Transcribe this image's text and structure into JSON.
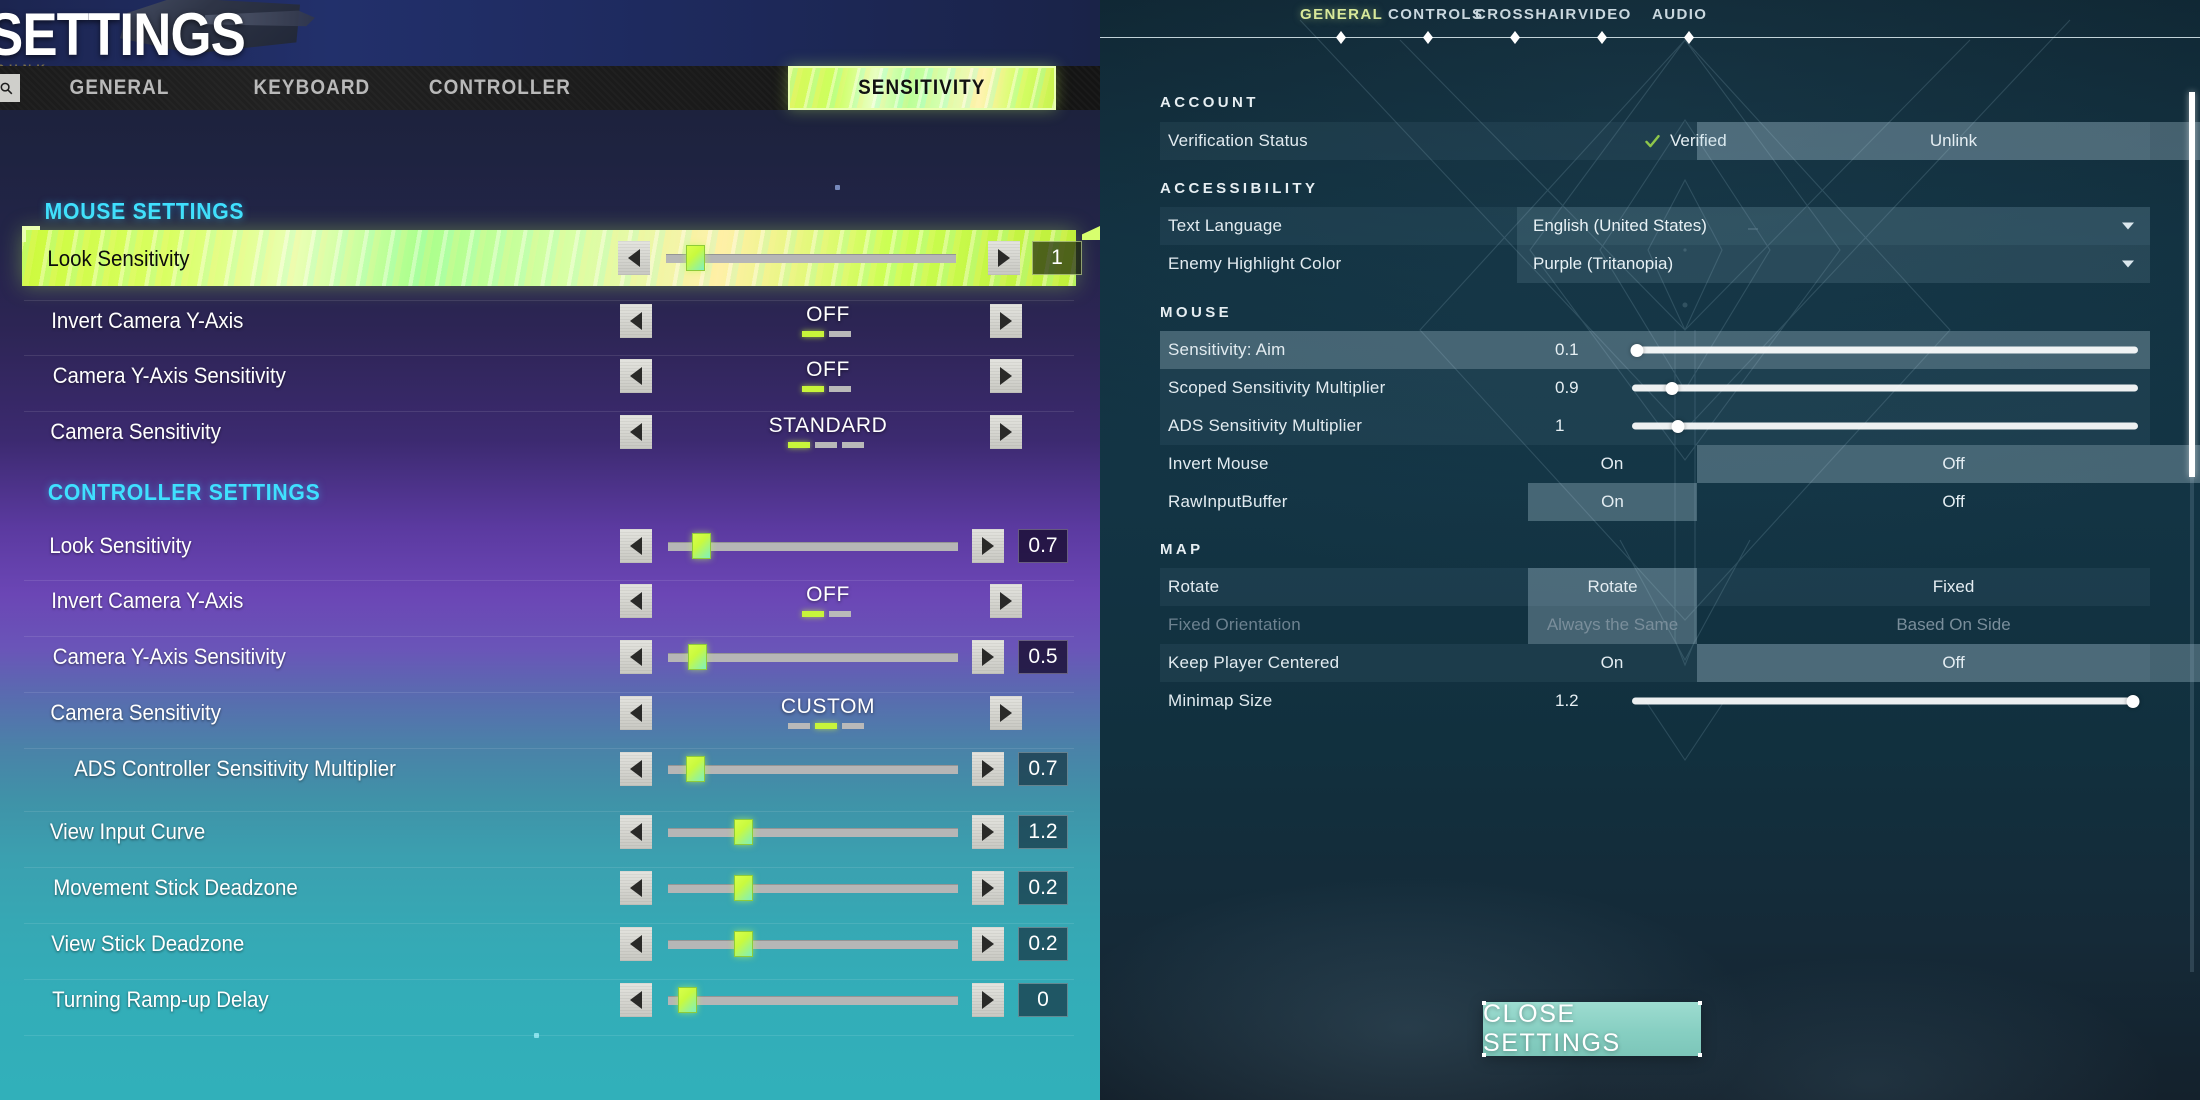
{
  "left": {
    "title": "SETTINGS",
    "subtitle": "PUNK",
    "search_icon": "search-icon",
    "tabs": [
      {
        "label": "GENERAL",
        "active": false
      },
      {
        "label": "KEYBOARD",
        "active": false
      },
      {
        "label": "CONTROLLER",
        "active": false
      },
      {
        "label": "SENSITIVITY",
        "active": true
      }
    ],
    "sections": [
      {
        "heading": "MOUSE SETTINGS",
        "rows": [
          {
            "label": "Look Sensitivity",
            "type": "slider",
            "value": "1",
            "fill": 0.05,
            "highlighted": true
          },
          {
            "label": "Invert Camera Y-Axis",
            "type": "option",
            "value": "OFF",
            "segments": 2,
            "segment_active": 0
          },
          {
            "label": "Camera Y-Axis Sensitivity",
            "type": "option",
            "value": "OFF",
            "segments": 2,
            "segment_active": 0
          },
          {
            "label": "Camera Sensitivity",
            "type": "option",
            "value": "STANDARD",
            "segments": 3,
            "segment_active": 0
          }
        ]
      },
      {
        "heading": "CONTROLLER SETTINGS",
        "rows": [
          {
            "label": "Look Sensitivity",
            "type": "slider",
            "value": "0.7",
            "fill": 0.1
          },
          {
            "label": "Invert Camera Y-Axis",
            "type": "option",
            "value": "OFF",
            "segments": 2,
            "segment_active": 0
          },
          {
            "label": "Camera Y-Axis Sensitivity",
            "type": "slider",
            "value": "0.5",
            "fill": 0.07
          },
          {
            "label": "Camera Sensitivity",
            "type": "option",
            "value": "CUSTOM",
            "segments": 3,
            "segment_active": 1
          },
          {
            "label": "ADS Controller Sensitivity Multiplier",
            "type": "slider",
            "value": "0.7",
            "fill": 0.06,
            "indent": true
          },
          {
            "label": "View Input Curve",
            "type": "slider",
            "value": "1.2",
            "fill": 0.22
          },
          {
            "label": "Movement Stick Deadzone",
            "type": "slider",
            "value": "0.2",
            "fill": 0.22
          },
          {
            "label": "View Stick Deadzone",
            "type": "slider",
            "value": "0.2",
            "fill": 0.22
          },
          {
            "label": "Turning Ramp-up Delay",
            "type": "slider",
            "value": "0",
            "fill": 0.02
          }
        ]
      }
    ]
  },
  "right": {
    "tabs": [
      {
        "label": "GENERAL",
        "active": true
      },
      {
        "label": "CONTROLS",
        "active": false
      },
      {
        "label": "CROSSHAIR",
        "active": false
      },
      {
        "label": "VIDEO",
        "active": false
      },
      {
        "label": "AUDIO",
        "active": false
      }
    ],
    "sections": [
      {
        "heading": "ACCOUNT",
        "rows": [
          {
            "label": "Verification Status",
            "type": "verify",
            "value": "Verified",
            "action": "Unlink",
            "check_color": "#8ec64a"
          }
        ]
      },
      {
        "heading": "ACCESSIBILITY",
        "rows": [
          {
            "label": "Text Language",
            "type": "dropdown",
            "value": "English (United States)"
          },
          {
            "label": "Enemy Highlight Color",
            "type": "dropdown",
            "value": "Purple (Tritanopia)"
          }
        ]
      },
      {
        "heading": "MOUSE",
        "rows": [
          {
            "label": "Sensitivity: Aim",
            "type": "slider",
            "value": "0.1",
            "fill": 0.01,
            "selected": true
          },
          {
            "label": "Scoped Sensitivity Multiplier",
            "type": "slider",
            "value": "0.9",
            "fill": 0.08
          },
          {
            "label": "ADS Sensitivity Multiplier",
            "type": "slider",
            "value": "1",
            "fill": 0.09
          },
          {
            "label": "Invert Mouse",
            "type": "toggle",
            "opt_a": "On",
            "opt_b": "Off",
            "selected_index": 1
          },
          {
            "label": "RawInputBuffer",
            "type": "toggle",
            "opt_a": "On",
            "opt_b": "Off",
            "selected_index": 0
          }
        ]
      },
      {
        "heading": "MAP",
        "rows": [
          {
            "label": "Rotate",
            "type": "toggle",
            "opt_a": "Rotate",
            "opt_b": "Fixed",
            "selected_index": 0
          },
          {
            "label": "Fixed Orientation",
            "type": "toggle",
            "opt_a": "Always the Same",
            "opt_b": "Based On Side",
            "selected_index": 0,
            "disabled": true
          },
          {
            "label": "Keep Player Centered",
            "type": "toggle",
            "opt_a": "On",
            "opt_b": "Off",
            "selected_index": 1
          },
          {
            "label": "Minimap Size",
            "type": "slider",
            "value": "1.2",
            "fill": 0.99
          }
        ]
      }
    ],
    "close_button": "CLOSE SETTINGS"
  },
  "colors": {
    "accent_cyan": "#3fe0ff",
    "accent_lime": "#c8f53a",
    "valorant_teal": "#87cfc2",
    "verified_green": "#8ec64a"
  }
}
